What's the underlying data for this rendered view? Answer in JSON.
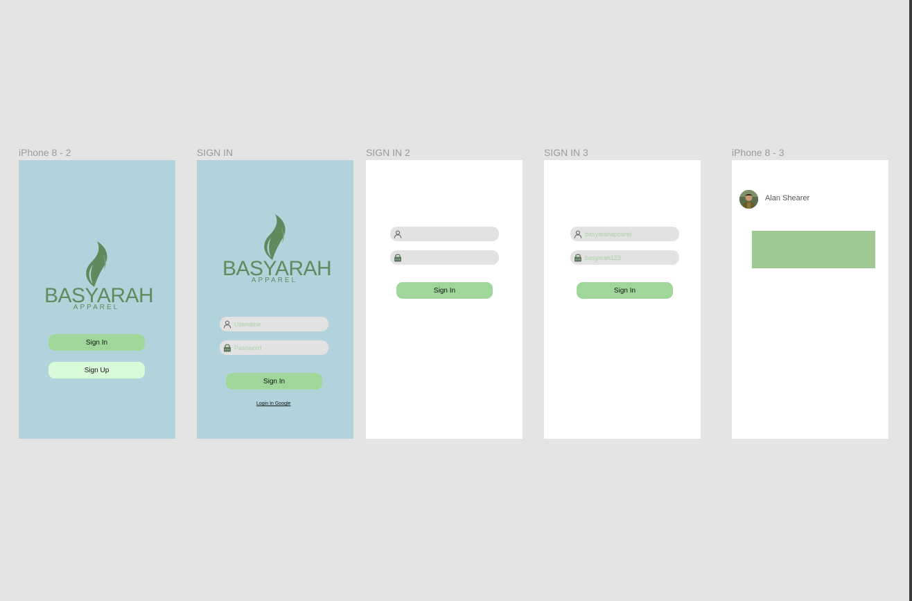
{
  "colors": {
    "canvas": "#e4e4e4",
    "frame_blue": "#b3d3dc",
    "brand_green": "#5f8a5e",
    "button_green": "#9fd79b",
    "button_mint": "#d9fad9",
    "placeholder_green": "#a8d4a5",
    "banner_green": "#9fc993"
  },
  "frames": [
    {
      "label": "iPhone 8 - 2",
      "logo": {
        "brand": "BASYARAH",
        "sub": "APPAREL"
      },
      "sign_in": "Sign In",
      "sign_up": "Sign Up"
    },
    {
      "label": "SIGN IN",
      "logo": {
        "brand": "BASYARAH",
        "sub": "APPAREL"
      },
      "username": {
        "icon": "user-icon",
        "placeholder": "Usename"
      },
      "password": {
        "icon": "lock-icon",
        "placeholder": "Password"
      },
      "sign_in": "Sign In",
      "google_link": "Login In Google"
    },
    {
      "label": "SIGN IN 2",
      "username": {
        "icon": "user-icon",
        "value": ""
      },
      "password": {
        "icon": "lock-icon",
        "value": ""
      },
      "sign_in": "Sign In"
    },
    {
      "label": "SIGN IN 3",
      "username": {
        "icon": "user-icon",
        "value": "basyarahapparel"
      },
      "password": {
        "icon": "lock-icon",
        "value": "basyarah123"
      },
      "sign_in": "Sign In"
    },
    {
      "label": "iPhone 8 - 3",
      "user_name": "Alan Shearer"
    }
  ]
}
